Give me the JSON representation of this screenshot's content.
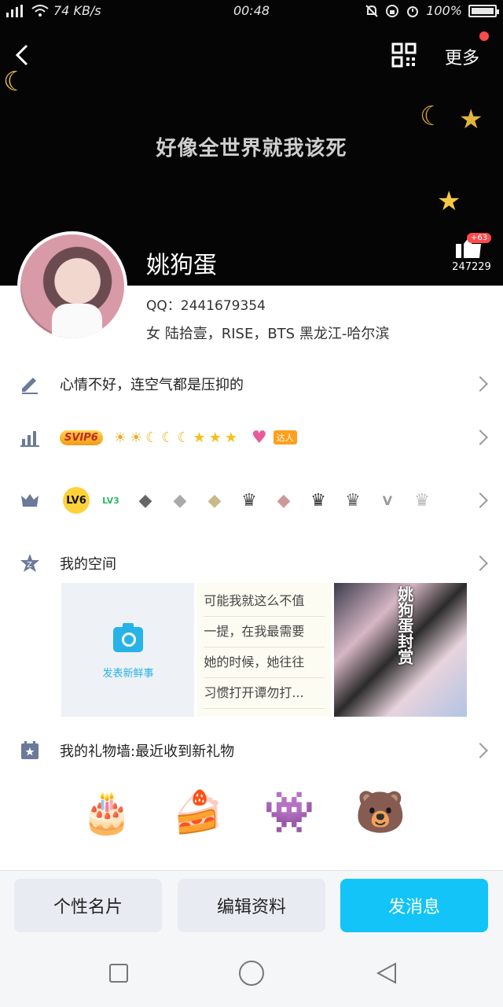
{
  "status_bar": {
    "network_speed": "74 KB/s",
    "time": "00:48",
    "battery": "100%"
  },
  "header": {
    "more_label": "更多"
  },
  "cover": {
    "text": "好像全世界就我该死"
  },
  "likes": {
    "badge": "+63",
    "count": "247229"
  },
  "profile": {
    "nickname": "姚狗蛋",
    "qq": "QQ：2441679354",
    "info": "女 陆拾壹，RISE，BTS 黑龙江-哈尔滨"
  },
  "rows": {
    "mood": "心情不好，连空气都是压抑的",
    "svip_label": "SVIP6",
    "level_icons": [
      "☀",
      "☀",
      "☾",
      "☾",
      "☾",
      "★",
      "★",
      "★"
    ],
    "daren_label": "达人",
    "vip_icons": [
      "LV6",
      "LV3",
      "◆",
      "◆",
      "◆",
      "♛",
      "◆",
      "♛",
      "♛",
      "V",
      "♛"
    ],
    "space_title": "我的空间",
    "gift_title": "我的礼物墙:最近收到新礼物"
  },
  "space": {
    "post_label": "发表新鲜事",
    "text_lines": [
      "可能我就这么不值",
      "一提，在我最需要",
      "她的时候，她往往",
      "习惯打开谭勿打..."
    ],
    "photo_caption": "姚狗蛋封赏"
  },
  "gifts": [
    "🎂",
    "🍰",
    "👾",
    "🐻"
  ],
  "actions": {
    "card": "个性名片",
    "edit": "编辑资料",
    "message": "发消息"
  },
  "colors": {
    "accent": "#12c4f7",
    "cover_bg": "#050505"
  }
}
